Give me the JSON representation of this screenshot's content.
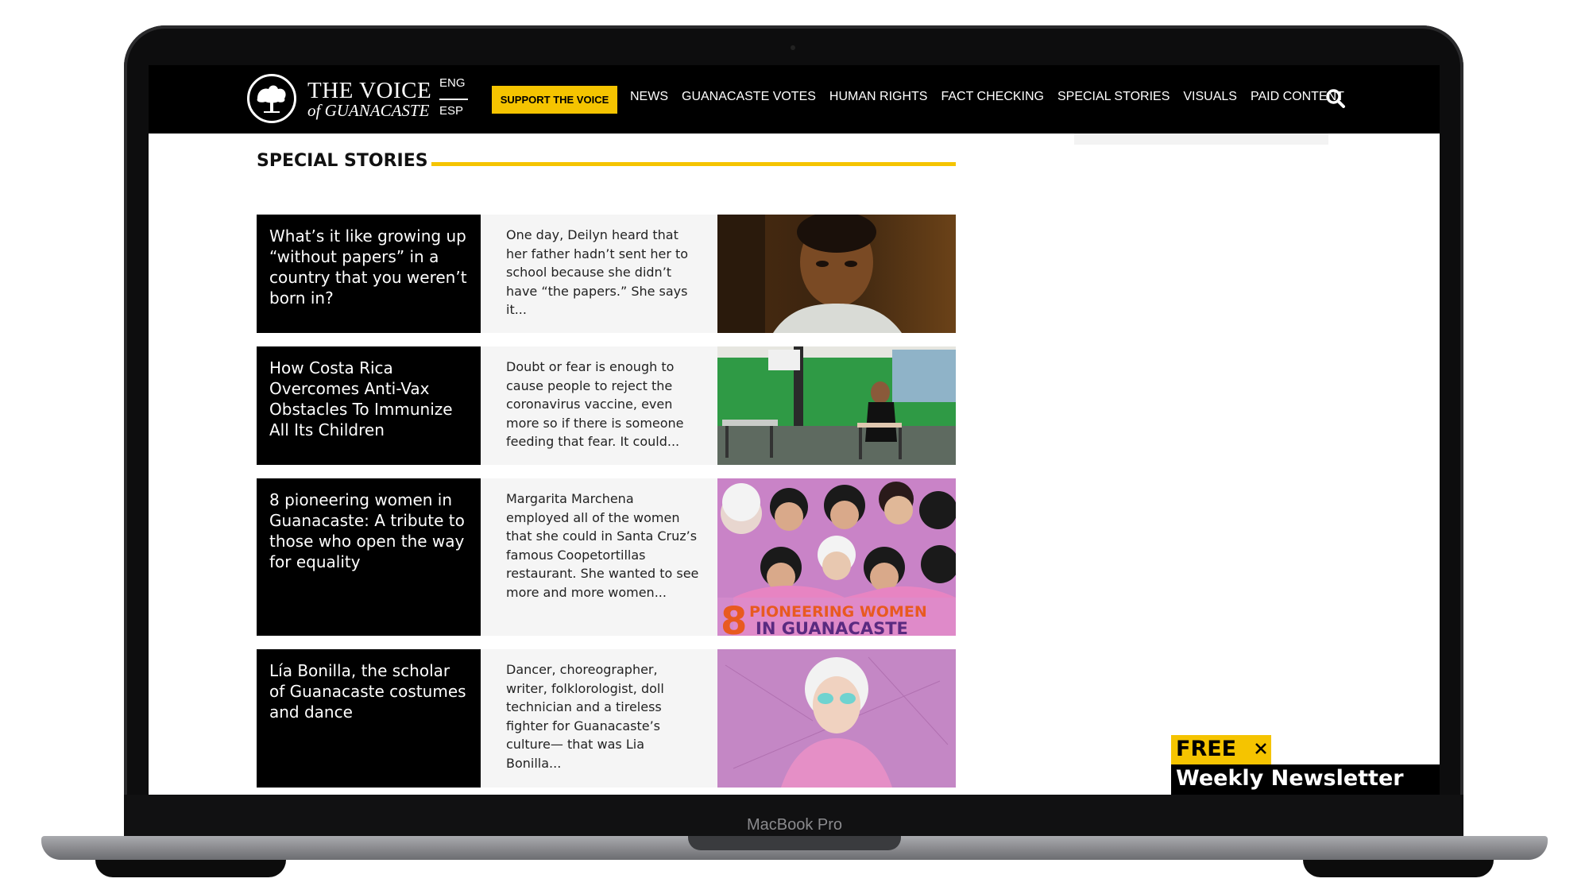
{
  "device": {
    "label": "MacBook Pro"
  },
  "header": {
    "logo_title": "THE VOICE",
    "logo_subtitle": "of GUANACASTE",
    "lang_eng": "ENG",
    "lang_esp": "ESP",
    "support_label": "SUPPORT THE VOICE",
    "nav": [
      "NEWS",
      "GUANACASTE VOTES",
      "HUMAN RIGHTS",
      "FACT CHECKING",
      "SPECIAL STORIES",
      "VISUALS",
      "PAID CONTENT"
    ],
    "search_icon": "search-icon"
  },
  "section": {
    "title": "SPECIAL STORIES"
  },
  "stories": [
    {
      "headline": "What’s it like growing up “without papers” in a country that you weren’t born in?",
      "excerpt": "One day, Deilyn heard that her father hadn’t sent her to school because she didn’t have “the papers.” She says it..."
    },
    {
      "headline": "How Costa Rica Overcomes Anti-Vax Obstacles To Immunize All Its Children",
      "excerpt": "Doubt or fear is enough to cause people to reject the coronavirus vaccine, even more so if there is someone feeding that fear. It could..."
    },
    {
      "headline": "8 pioneering women in Guanacaste: A tribute to those who open the way for equality",
      "excerpt": "Margarita Marchena employed all of the women that she could in Santa Cruz’s famous Coopetortillas restaurant. She wanted to see more and more women...",
      "image_number": "8",
      "image_text_1": "PIONEERING WOMEN",
      "image_text_2": "IN GUANACASTE"
    },
    {
      "headline": "Lía Bonilla, the scholar of Guanacaste costumes and dance",
      "excerpt": "Dancer, choreographer, writer, folklorologist, doll technician and a tireless fighter for Guanacaste’s culture— that was Lia Bonilla..."
    }
  ],
  "newsletter": {
    "free_label": "FREE",
    "title": "Weekly Newsletter"
  },
  "colors": {
    "accent": "#f5c400",
    "header_bg": "#000000",
    "excerpt_bg": "#f5f5f5"
  }
}
